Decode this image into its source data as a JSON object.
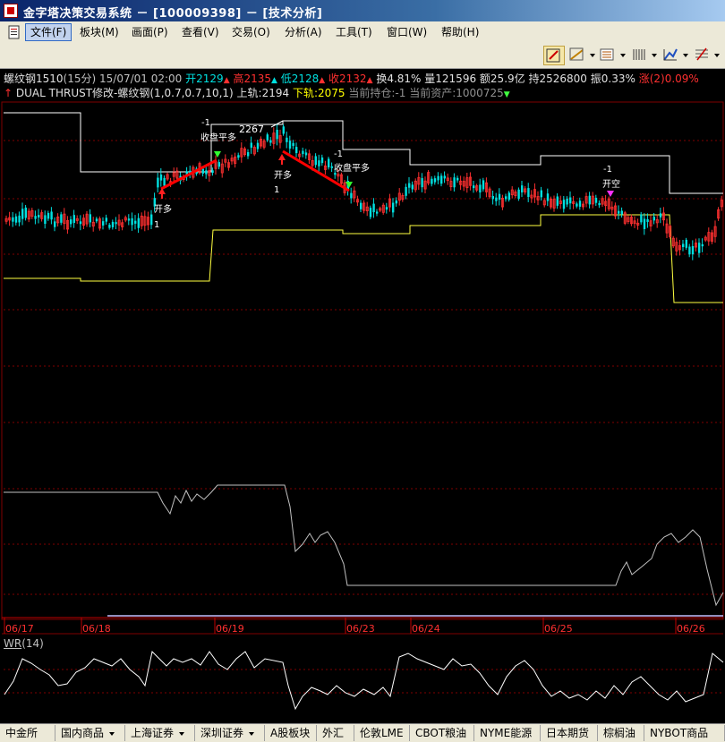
{
  "window": {
    "title": "金字塔决策交易系统 － [100009398] － [技术分析]"
  },
  "menu": {
    "items": [
      {
        "label": "文件(F)",
        "active": true
      },
      {
        "label": "板块(M)"
      },
      {
        "label": "画面(P)"
      },
      {
        "label": "查看(V)"
      },
      {
        "label": "交易(O)"
      },
      {
        "label": "分析(A)"
      },
      {
        "label": "工具(T)"
      },
      {
        "label": "窗口(W)"
      },
      {
        "label": "帮助(H)"
      }
    ]
  },
  "toolbar": {
    "icons": [
      "draw-mode-icon",
      "line-tool-icon",
      "indicator-list-icon",
      "bar-chart-icon",
      "chart-style-icon",
      "fib-tool-icon"
    ]
  },
  "quote": {
    "symbol": "螺纹钢1510",
    "period": "(15分)",
    "datetime": "15/07/01 02:00",
    "open": "开2129",
    "high": "高2135",
    "low": "低2128",
    "close": "收2132",
    "turnover": "换4.81%",
    "volume": "量121596",
    "amount": "额25.9亿",
    "position": "持2526800",
    "amplitude": "振0.33%",
    "change": "涨(2)0.09%"
  },
  "strategy": {
    "name": "DUAL THRUST修改-螺纹钢(1,0.7,0.7,10,1)",
    "upper": "上轨:2194",
    "lower": "下轨:2075",
    "holding": "当前持仓:-1",
    "assets": "当前资产:1000725"
  },
  "signals": [
    {
      "text": "开多",
      "qty": "1"
    },
    {
      "text": "收盘平多",
      "qty": "-1"
    },
    {
      "text": "开多",
      "qty": "1"
    },
    {
      "text": "收盘平多",
      "qty": "-1"
    },
    {
      "text": "开空",
      "qty": "-1"
    }
  ],
  "peak_label": "2267",
  "dates": [
    "06/17",
    "06/18",
    "06/19",
    "06/23",
    "06/24",
    "06/25",
    "06/26"
  ],
  "wr": {
    "name": "WR",
    "param": "(14)"
  },
  "bottom_tabs": [
    {
      "label": "中金所"
    },
    {
      "label": "国内商品",
      "dropdown": true
    },
    {
      "label": "上海证券",
      "dropdown": true
    },
    {
      "label": "深圳证券",
      "dropdown": true
    },
    {
      "label": "A股板块"
    },
    {
      "label": "外汇"
    },
    {
      "label": "伦敦LME"
    },
    {
      "label": "CBOT粮油"
    },
    {
      "label": "NYME能源"
    },
    {
      "label": "日本期货"
    },
    {
      "label": "棕榈油"
    },
    {
      "label": "NYBOT商品"
    }
  ],
  "colors": {
    "up": "#ff3030",
    "down": "#00e0e0",
    "upper_band": "#ffffff",
    "lower_band": "#ffff40",
    "trade_line": "#ff0000",
    "grid": "#800000"
  }
}
